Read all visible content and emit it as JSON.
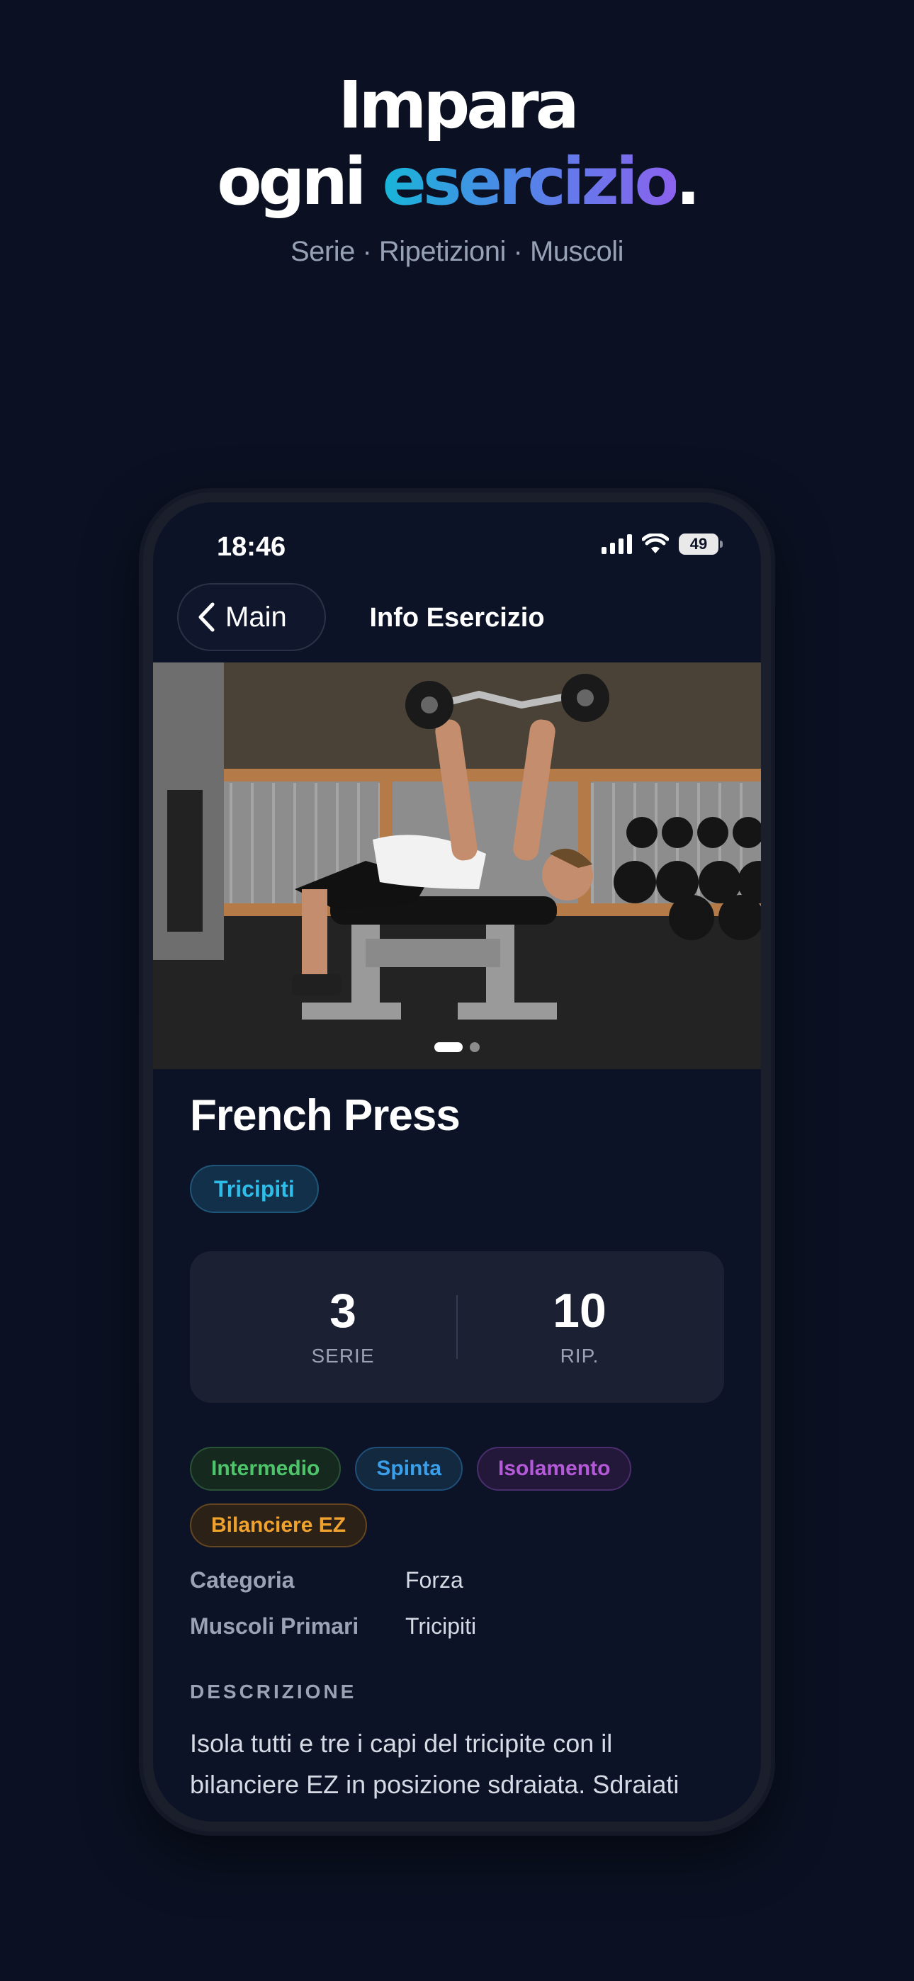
{
  "hero": {
    "line1": "Impara",
    "line2_prefix": "ogni ",
    "line2_accent": "esercizio",
    "line2_suffix": ".",
    "subtitle": "Serie · Ripetizioni · Muscoli"
  },
  "status_bar": {
    "time": "18:46",
    "battery": "49"
  },
  "nav": {
    "back_label": "Main",
    "title": "Info Esercizio"
  },
  "carousel": {
    "image_description_icon": "exercise-photo",
    "pages": 2,
    "active_page": 1
  },
  "exercise": {
    "name": "French Press",
    "muscle_chip": "Tricipiti",
    "stats": [
      {
        "value": "3",
        "label": "SERIE"
      },
      {
        "value": "10",
        "label": "RIP."
      }
    ],
    "tags": [
      {
        "label": "Intermedio",
        "color": "#4ec46a"
      },
      {
        "label": "Spinta",
        "color": "#3a9fe8"
      },
      {
        "label": "Isolamento",
        "color": "#b45ad8"
      },
      {
        "label": "Bilanciere EZ",
        "color": "#f0a22e"
      }
    ],
    "info": [
      {
        "key": "Categoria",
        "value": "Forza"
      },
      {
        "key": "Muscoli Primari",
        "value": "Tricipiti"
      }
    ],
    "description_heading": "DESCRIZIONE",
    "description": "Isola tutti e tre i capi del tricipite con il bilanciere EZ in posizione sdraiata. Sdraiati"
  },
  "colors": {
    "background": "#0b1122",
    "accent_gradient": [
      "#17b6d8",
      "#8b62ee"
    ]
  }
}
